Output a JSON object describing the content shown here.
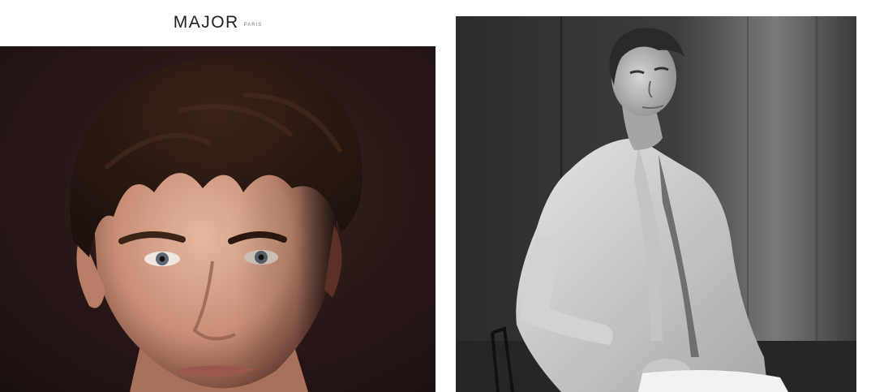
{
  "logo": {
    "brand": "MAJOR",
    "city": "PARIS"
  },
  "photos": {
    "left": {
      "icon": "portrait-photo-color"
    },
    "right": {
      "icon": "seated-model-photo-bw"
    }
  }
}
